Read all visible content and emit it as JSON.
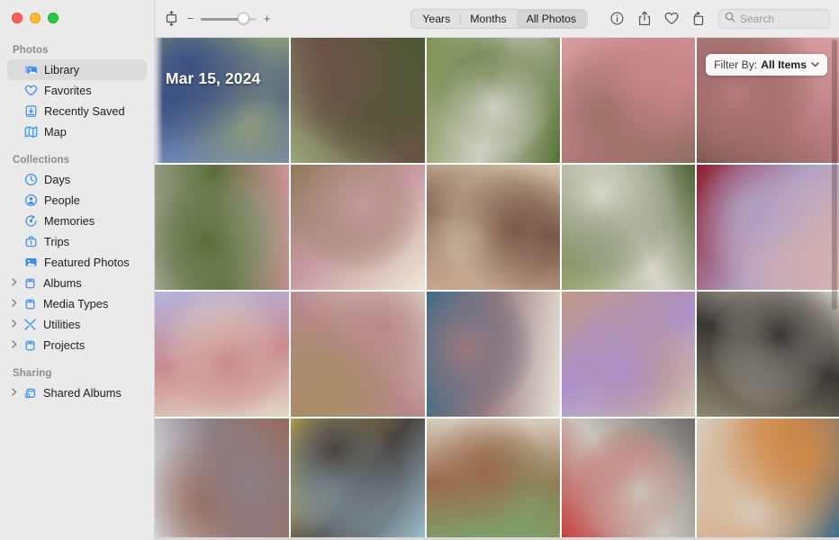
{
  "window": {
    "traffic_lights": [
      "close",
      "minimize",
      "zoom"
    ]
  },
  "sidebar": {
    "sections": [
      {
        "header": "Photos",
        "items": [
          {
            "label": "Library",
            "icon": "photos-library-icon",
            "selected": true,
            "expandable": false
          },
          {
            "label": "Favorites",
            "icon": "heart-icon",
            "selected": false,
            "expandable": false
          },
          {
            "label": "Recently Saved",
            "icon": "tray-down-icon",
            "selected": false,
            "expandable": false
          },
          {
            "label": "Map",
            "icon": "map-icon",
            "selected": false,
            "expandable": false
          }
        ]
      },
      {
        "header": "Collections",
        "items": [
          {
            "label": "Days",
            "icon": "clock-icon",
            "selected": false,
            "expandable": false
          },
          {
            "label": "People",
            "icon": "person-circle-icon",
            "selected": false,
            "expandable": false
          },
          {
            "label": "Memories",
            "icon": "memories-icon",
            "selected": false,
            "expandable": false
          },
          {
            "label": "Trips",
            "icon": "suitcase-icon",
            "selected": false,
            "expandable": false
          },
          {
            "label": "Featured Photos",
            "icon": "photo-icon",
            "selected": false,
            "expandable": false
          },
          {
            "label": "Albums",
            "icon": "album-icon",
            "selected": false,
            "expandable": true
          },
          {
            "label": "Media Types",
            "icon": "album-icon",
            "selected": false,
            "expandable": true
          },
          {
            "label": "Utilities",
            "icon": "tools-icon",
            "selected": false,
            "expandable": true
          },
          {
            "label": "Projects",
            "icon": "album-icon",
            "selected": false,
            "expandable": true
          }
        ]
      },
      {
        "header": "Sharing",
        "items": [
          {
            "label": "Shared Albums",
            "icon": "shared-album-icon",
            "selected": false,
            "expandable": true
          }
        ]
      }
    ]
  },
  "toolbar": {
    "fit_icon": "aspect-fit-icon",
    "zoom_out_label": "−",
    "zoom_in_label": "+",
    "zoom_value": 66,
    "segments": [
      {
        "label": "Years",
        "active": false
      },
      {
        "label": "Months",
        "active": false
      },
      {
        "label": "All Photos",
        "active": true
      }
    ],
    "icons": [
      {
        "name": "info-icon"
      },
      {
        "name": "share-icon"
      },
      {
        "name": "heart-icon"
      },
      {
        "name": "rotate-icon"
      }
    ],
    "search": {
      "placeholder": "Search",
      "value": "",
      "icon": "search-icon"
    }
  },
  "grid": {
    "date_overlay": "Mar 15, 2024",
    "filter": {
      "label": "Filter By:",
      "value": "All Items",
      "chevron": "⌄"
    },
    "photos": [
      {
        "alt": "person-in-blue-knit-sweater",
        "c1": "#6d86b4",
        "c2": "#3b5183",
        "c3": "#8d9a7e"
      },
      {
        "alt": "person-with-binoculars-smiling",
        "c1": "#9aa87a",
        "c2": "#6a5246",
        "c3": "#4a5a32"
      },
      {
        "alt": "two-people-outdoors-in-garden",
        "c1": "#7d9152",
        "c2": "#cfcec2",
        "c3": "#55702f"
      },
      {
        "alt": "two-people-embracing-in-pink",
        "c1": "#d79ca0",
        "c2": "#c7848b",
        "c3": "#8f6c5e"
      },
      {
        "alt": "children-hugging-in-pink-top",
        "c1": "#d9a0a4",
        "c2": "#b77a80",
        "c3": "#7d5a4e"
      },
      {
        "alt": "two-children-hugging-in-garden",
        "c1": "#cf9499",
        "c2": "#5c6e3a",
        "c3": "#9aa38c"
      },
      {
        "alt": "white-dahlia-flower-closeup",
        "c1": "#efe7d8",
        "c2": "#c79aa0",
        "c3": "#8e7a58"
      },
      {
        "alt": "family-group-cuddling-on-couch",
        "c1": "#c9a58e",
        "c2": "#7a5a49",
        "c3": "#d9c5ab"
      },
      {
        "alt": "child-with-binoculars-in-garden",
        "c1": "#8fa06a",
        "c2": "#d8d6cc",
        "c3": "#4f6334"
      },
      {
        "alt": "two-people-on-red-sofa",
        "c1": "#8d2030",
        "c2": "#b0a0c6",
        "c3": "#d9b3ad"
      },
      {
        "alt": "family-cuddling-child-in-lavender",
        "c1": "#b5b4dd",
        "c2": "#c98a8f",
        "c3": "#e4d7c4"
      },
      {
        "alt": "adult-braiding-childs-hair",
        "c1": "#e3dccd",
        "c2": "#b8888c",
        "c3": "#a78d63"
      },
      {
        "alt": "family-sitting-by-window",
        "c1": "#e6e3d8",
        "c2": "#9d7a7e",
        "c3": "#3f6a86"
      },
      {
        "alt": "parent-styling-childs-hair",
        "c1": "#dcd3c2",
        "c2": "#ab8fc9",
        "c3": "#c09a86"
      },
      {
        "alt": "adult-hugging-child-by-curtain",
        "c1": "#8f8a72",
        "c2": "#3a3632",
        "c3": "#d7d2c6"
      },
      {
        "alt": "two-children-playing-by-window",
        "c1": "#dfe4e8",
        "c2": "#8c7f86",
        "c3": "#9a6b5c"
      },
      {
        "alt": "parent-and-child-in-yellow-blanket",
        "c1": "#e8c447",
        "c2": "#4a4442",
        "c3": "#9ec3d4"
      },
      {
        "alt": "child-at-table-indoors",
        "c1": "#d8cfc0",
        "c2": "#9a6a4b",
        "c3": "#7fa06a"
      },
      {
        "alt": "child-bending-over-toy-pieces",
        "c1": "#6f6c68",
        "c2": "#c9c5bd",
        "c3": "#c23b3b"
      },
      {
        "alt": "family-playing-blocks-on-rug",
        "c1": "#3c6f8e",
        "c2": "#d08a4a",
        "c3": "#d9cfc2"
      }
    ]
  }
}
